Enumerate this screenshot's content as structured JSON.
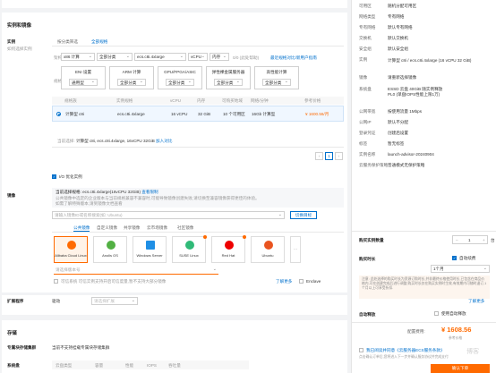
{
  "instance": {
    "section_label": "实例和镜像",
    "label": "实例",
    "sublabel": "如何选择实例",
    "tabs": [
      "按分类筛选",
      "全部规格"
    ],
    "filter": {
      "arch_label": "架构",
      "arch_value": "x86 计算",
      "category_value": "全部分类",
      "search_value": "ecs.c8i.4xlarge",
      "vcpu_value": "vCPU",
      "mem_value": "内存",
      "compare_link": "最近规格对比/新用户指南",
      "count_text": "0/0 (此处帮助)"
    },
    "type_label": "规格",
    "type_filters": [
      {
        "title": "ENI 设置",
        "sub": "通用型"
      },
      {
        "title": "ARM 计算",
        "sub": "全部分类"
      },
      {
        "title": "GPU/FPGA/ASIC",
        "sub": "全部分类"
      },
      {
        "title": "弹性裸金属服务器",
        "sub": "全部分类"
      },
      {
        "title": "高性能计算",
        "sub": "全部分类"
      }
    ],
    "table": {
      "headers": [
        "规格族",
        "实例规格",
        "vCPU",
        "内存",
        "可购买地域",
        "网络/分钟",
        "参考价格"
      ],
      "row": [
        "计算型 c8i",
        "ecs.c8i.4xlarge",
        "16 vCPU",
        "32 GiB",
        "10 个可用区",
        "16Gb 计算型",
        "¥ 1600.56/月"
      ]
    },
    "selected_prefix": "当前选择:",
    "selected_text": "计算型 c8i, ecs.c8i.4xlarge, 16vCPU 32GiB",
    "add_compare": "加入对比",
    "pagination": {
      "current": "1"
    }
  },
  "io_optimized": {
    "label": "I/O 优化实例"
  },
  "image": {
    "label": "镜像",
    "notice_title": "当前选择规格:",
    "notice_value": "ecs.c8i.4xlarge(16vCPU 32GiB)",
    "notice_link": "查看限制",
    "notice_line2": "公共镜像中选定的企业版本与当前规格兼容不兼容时,可能导致镜像创建失败,请切换至兼容镜像获得更佳的体验。",
    "notice_line3": "如需了解特殊版本,请到镜像文档查看",
    "search_placeholder": "请输入镜像ID或名称搜索(如: Ubuntu)",
    "search_button": "切换目标",
    "tabs": [
      "公共镜像",
      "自定义镜像",
      "共享镜像",
      "云市场镜像",
      "社区镜像"
    ],
    "os_list": [
      "Alibaba Cloud Linux",
      "Anolis OS",
      "Windows Server",
      "SUSE Linux",
      "Red Hat",
      "Ubuntu"
    ],
    "version_placeholder": "请选择版本号",
    "security_check": "可信系统 可信实例支持开启可信度量,暂不支持大部分镜像",
    "security_link": "了解更多",
    "encrypt_label": "Enclave"
  },
  "extra": {
    "label": "扩展程序",
    "value": "驱动",
    "placeholder": "请选择扩展"
  },
  "storage": {
    "label": "存储",
    "local_label": "专属块存储集群",
    "local_value": "当前不支持挂载专属块存储集群",
    "system_disk_label": "系统盘",
    "disk_headers": [
      "云盘类型",
      "容量",
      "性能",
      "IOPS",
      "吞吐量"
    ]
  },
  "summary": {
    "rows": [
      {
        "label": "可用区",
        "value": "随机分配可用区"
      },
      {
        "label": "网络类型",
        "value": "专有网络"
      },
      {
        "label": "专有网络",
        "value": "默认专有网络"
      },
      {
        "label": "交换机",
        "value": "默认交换机"
      },
      {
        "label": "安全组",
        "value": "默认安全组"
      },
      {
        "label": "实例",
        "value": "计算型 c8i / ecs.c8i.4xlarge (16 vCPU 32 GiB)"
      },
      {
        "label": "镜像",
        "value": "请重新选择镜像"
      },
      {
        "label": "系统盘",
        "value": "ESSD 云盘 40GiB 随实例释放 PL0 (单盘IOPS性能上限1万)"
      },
      {
        "label": "公网带宽",
        "value": "按使用流量 1Mbps"
      },
      {
        "label": "公网IP",
        "value": "默认不分配"
      },
      {
        "label": "登录凭证",
        "value": "创建后设置"
      },
      {
        "label": "标签",
        "value": "暂无标签"
      },
      {
        "label": "实例名称",
        "value": "launch-advisor-20240904"
      },
      {
        "label": "云服务保护策略",
        "value": "普通模式无保护策略"
      }
    ],
    "quantity_label": "购买实例数量",
    "quantity_value": "1",
    "quantity_unit": "台",
    "duration_label": "购买时长",
    "auto_renew": "自动续费",
    "duration_value": "1个月",
    "duration_note": "注意: 此处选择的购买时长为资源订购时长,并非最终价格使用时长,已包含在商品价格内,可在创建完成后进行调整,购买时长仅在购买实例时生效,有效期内可随时退订,1个月以上可享受折扣.",
    "duration_link": "了解更多",
    "release_label": "自动释放",
    "release_check": "使用自动释放",
    "price_label": "配置费用:",
    "price_value": "¥ 1608.56",
    "price_note": "参考价格",
    "agree_text": "我已阅读并同意《云服务器ECS服务条款》",
    "agree_note": "点击确认订单后,您将进入下一步并确认服务协议并完成支付",
    "create_button": "确认下单",
    "watermark": "博客"
  },
  "colors": {
    "accent": "#ff6a00",
    "link": "#0070cc"
  }
}
